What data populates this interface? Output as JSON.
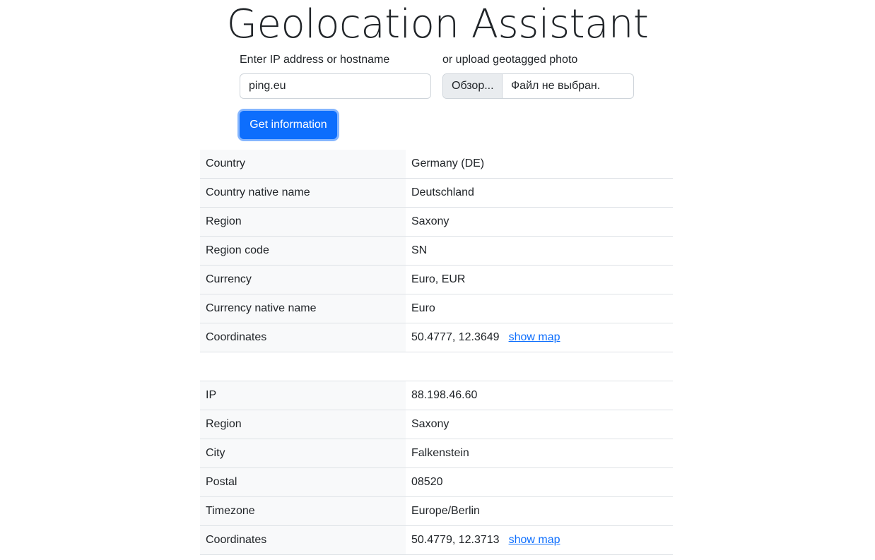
{
  "title": "Geolocation Assistant",
  "form": {
    "ip_label": "Enter IP address or hostname",
    "ip_value": "ping.eu",
    "photo_label": "or upload geotagged photo",
    "file_button": "Обзор...",
    "file_status": "Файл не выбран.",
    "submit_label": "Get information"
  },
  "country_table": [
    {
      "key": "Country",
      "value": "Germany (DE)"
    },
    {
      "key": "Country native name",
      "value": "Deutschland"
    },
    {
      "key": "Region",
      "value": "Saxony"
    },
    {
      "key": "Region code",
      "value": "SN"
    },
    {
      "key": "Currency",
      "value": "Euro, EUR"
    },
    {
      "key": "Currency native name",
      "value": "Euro"
    },
    {
      "key": "Coordinates",
      "value": "50.4777, 12.3649",
      "link": "show map"
    }
  ],
  "ip_table": [
    {
      "key": "IP",
      "value": "88.198.46.60"
    },
    {
      "key": "Region",
      "value": "Saxony"
    },
    {
      "key": "City",
      "value": "Falkenstein"
    },
    {
      "key": "Postal",
      "value": "08520"
    },
    {
      "key": "Timezone",
      "value": "Europe/Berlin"
    },
    {
      "key": "Coordinates",
      "value": "50.4779, 12.3713",
      "link": "show map"
    }
  ]
}
